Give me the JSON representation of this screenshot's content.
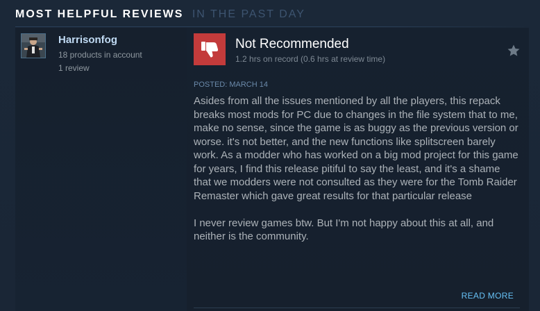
{
  "section": {
    "title": "MOST HELPFUL REVIEWS",
    "subtitle": "IN THE PAST DAY"
  },
  "author": {
    "name": "Harrisonfog",
    "products": "18 products in account",
    "reviews": "1 review"
  },
  "review": {
    "verdict": "Not Recommended",
    "hours": "1.2 hrs on record (0.6 hrs at review time)",
    "posted": "POSTED: MARCH 14",
    "paragraphs": [
      "Asides from all the issues mentioned by all the players, this repack breaks most mods for PC due to changes in the file system that to me, make no sense, since the game is as buggy as the previous version or worse. it's not better, and the new functions like splitscreen barely work. As a modder who has worked on a big mod project for this game for years, I find this release pitiful to say the least, and it's a shame that we modders were not consulted as they were for the Tomb Raider Remaster which gave great results for that particular release",
      "I never review games btw. But I'm not happy about this at all, and neither is the community."
    ],
    "read_more": "READ MORE",
    "vote_icon": "thumbs-down-icon",
    "award_icon": "star-icon"
  },
  "colors": {
    "background": "#1b2838",
    "accent_link": "#66c0f4",
    "author_name": "#c1dbf4",
    "not_recommended": "#c33b3b",
    "body_text": "#acb2b8"
  }
}
